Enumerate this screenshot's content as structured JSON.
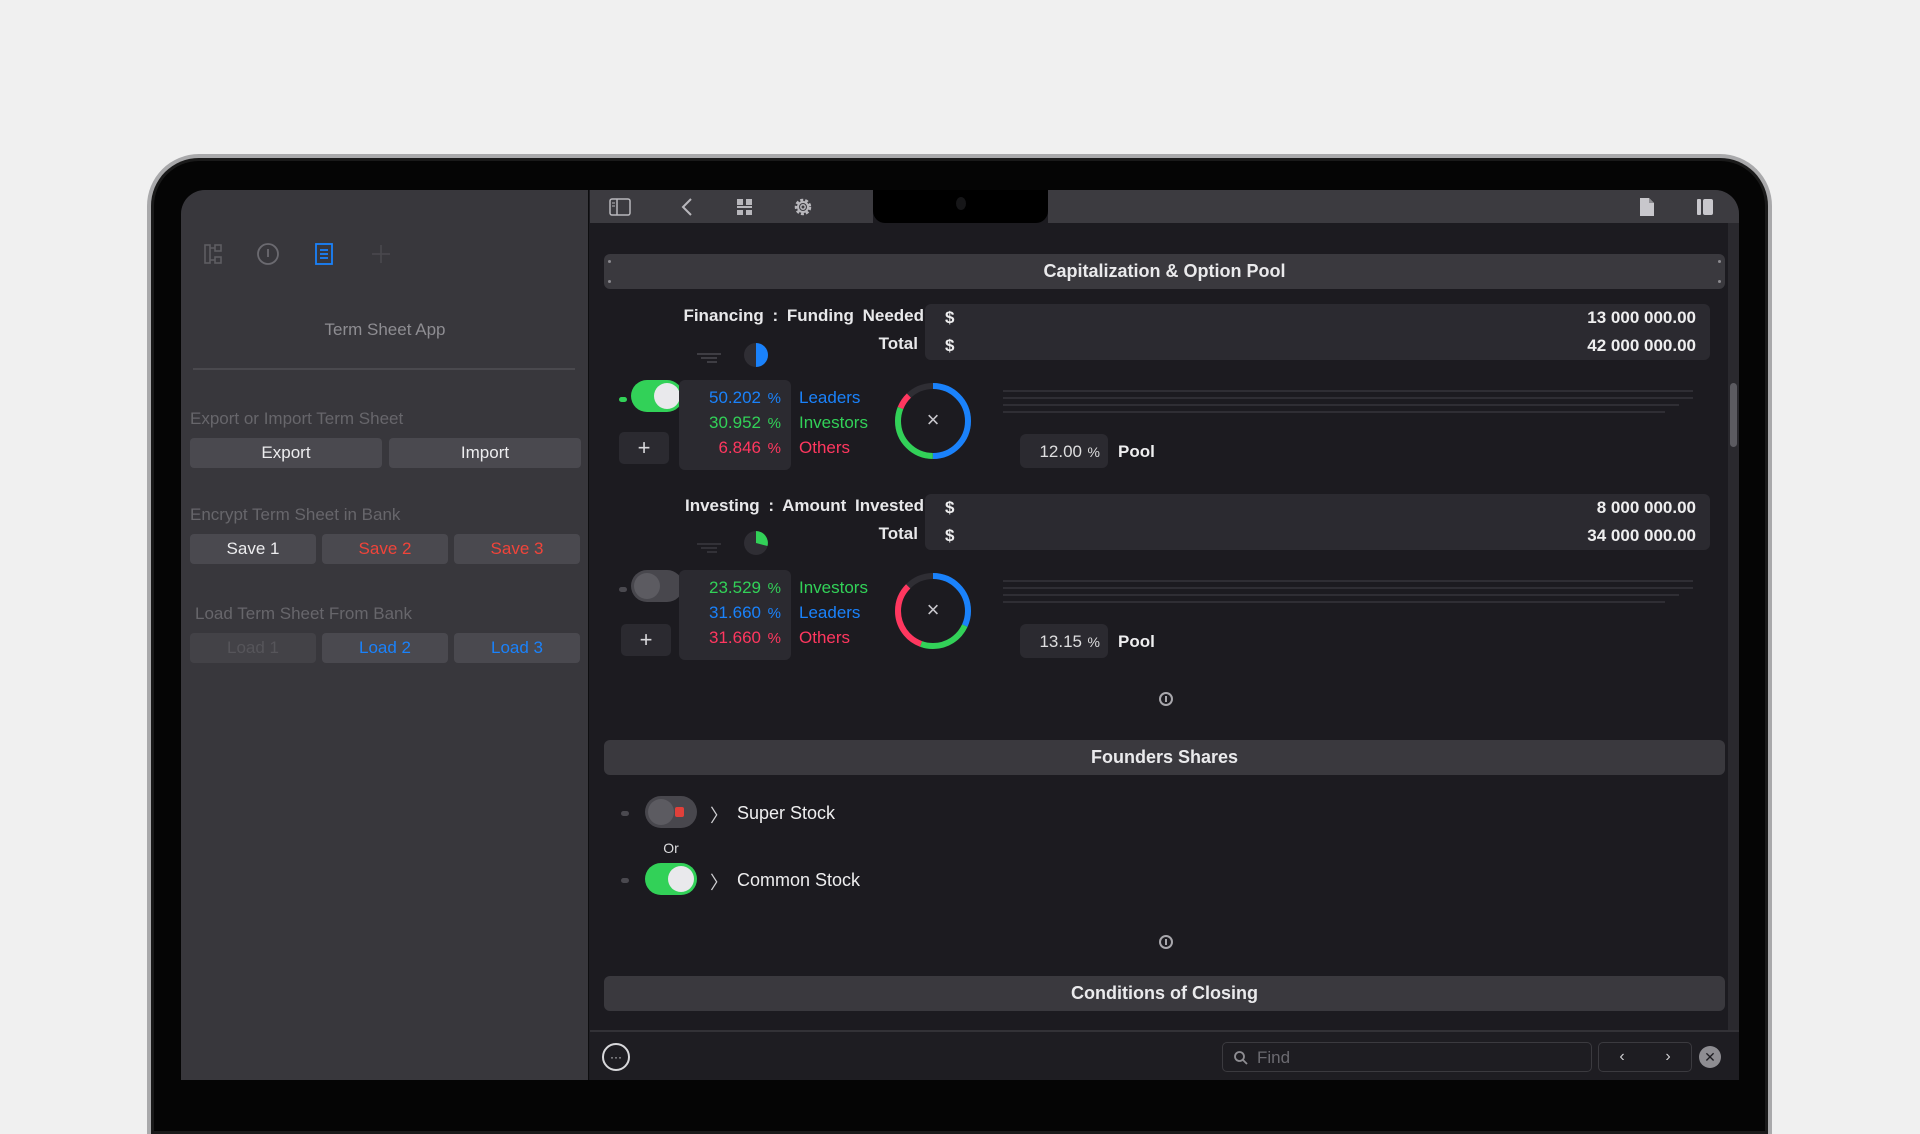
{
  "sidebar": {
    "tabs": [
      {
        "icon": "hierarchy-icon",
        "active": false
      },
      {
        "icon": "info-icon",
        "active": false
      },
      {
        "icon": "document-icon",
        "active": true
      },
      {
        "icon": "plus-icon",
        "active": false
      }
    ],
    "app_title": "Term Sheet App",
    "export_import": {
      "label": "Export or Import Term Sheet",
      "export_label": "Export",
      "import_label": "Import"
    },
    "encrypt": {
      "label": "Encrypt Term Sheet in Bank",
      "buttons": [
        "Save 1",
        "Save 2",
        "Save 3"
      ]
    },
    "load": {
      "label": "Load Term Sheet From Bank",
      "buttons": [
        "Load 1",
        "Load 2",
        "Load 3"
      ]
    }
  },
  "toolbar": {
    "left_icons": [
      "sidebar-toggle-icon",
      "back-chevron-icon",
      "grid-icon",
      "gear-icon"
    ],
    "right_icons": [
      "document-icon",
      "inspector-icon"
    ]
  },
  "capitalization": {
    "title": "Capitalization & Option Pool",
    "financing": {
      "label": "Financing : Funding Needed",
      "total_label": "Total",
      "currency": "$",
      "funding_needed": "13 000 000.00",
      "total": "42 000 000.00",
      "toggle_on": true,
      "split": [
        {
          "value": "50.202",
          "name": "Leaders",
          "color": "#1a82fb"
        },
        {
          "value": "30.952",
          "name": "Investors",
          "color": "#32d158"
        },
        {
          "value": "6.846",
          "name": "Others",
          "color": "#ff375f"
        }
      ],
      "pct_symbol": "%",
      "pool_value": "12.00",
      "pool_label": "Pool",
      "add_label": "+",
      "clear_label": "×"
    },
    "investing": {
      "label": "Investing : Amount Invested",
      "total_label": "Total",
      "currency": "$",
      "amount_invested": "8 000 000.00",
      "total": "34 000 000.00",
      "toggle_on": false,
      "split": [
        {
          "value": "23.529",
          "name": "Investors",
          "color": "#32d158"
        },
        {
          "value": "31.660",
          "name": "Leaders",
          "color": "#1a82fb"
        },
        {
          "value": "31.660",
          "name": "Others",
          "color": "#ff375f"
        }
      ],
      "pct_symbol": "%",
      "pool_value": "13.15",
      "pool_label": "Pool",
      "add_label": "+",
      "clear_label": "×"
    }
  },
  "founders": {
    "title": "Founders Shares",
    "options": [
      {
        "label": "Super Stock",
        "toggle_on": false
      },
      {
        "label": "Common Stock",
        "toggle_on": true
      }
    ],
    "or_label": "Or"
  },
  "closing": {
    "title": "Conditions of Closing"
  },
  "findbar": {
    "placeholder": "Find",
    "more_label": "···",
    "prev_label": "‹",
    "next_label": "›",
    "close_label": "✕"
  }
}
